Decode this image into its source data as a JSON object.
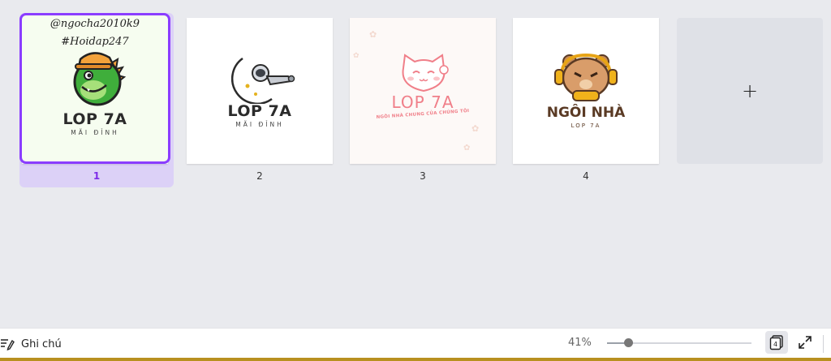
{
  "pages": [
    {
      "number": "1",
      "selected": true,
      "handle": "@ngocha2010k9",
      "tag": "#Hoidap247",
      "title": "LOP 7A",
      "subtitle": "MÃI ĐỈNH"
    },
    {
      "number": "2",
      "selected": false,
      "title": "LOP 7A",
      "subtitle": "MÃI ĐỈNH"
    },
    {
      "number": "3",
      "selected": false,
      "title": "LOP 7A",
      "subtitle": "NGÔI NHÀ CHUNG CỦA  CHÚNG TÔI"
    },
    {
      "number": "4",
      "selected": false,
      "title": "NGÔI NHÀ",
      "subtitle": "LOP 7A"
    }
  ],
  "add_page_label": "+",
  "bottom": {
    "notes_label": "Ghi chú",
    "zoom_label": "41%",
    "zoom_level": 0.41,
    "page_count": "4"
  },
  "colors": {
    "accent": "#8b3dff",
    "selection_bg": "#dcd1f7",
    "bottom_accent": "#b8901f"
  }
}
